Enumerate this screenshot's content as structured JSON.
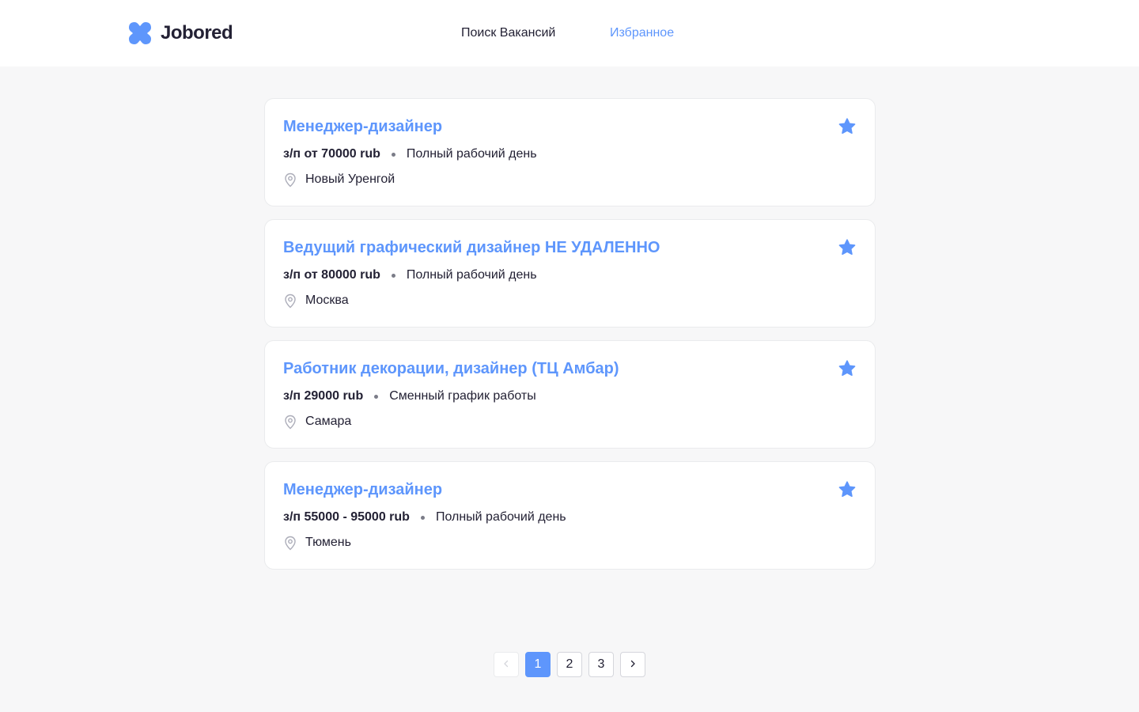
{
  "app": {
    "logo_text": "Jobored",
    "accent": "#5E96FC"
  },
  "nav": {
    "search": "Поиск Вакансий",
    "favorites": "Избранное",
    "active": "favorites"
  },
  "vacancies": [
    {
      "title": "Менеджер-дизайнер",
      "salary": "з/п от 70000 rub",
      "schedule": "Полный рабочий день",
      "location": "Новый Уренгой",
      "favorite": true
    },
    {
      "title": "Ведущий графический дизайнер НЕ УДАЛЕННО",
      "salary": "з/п от 80000 rub",
      "schedule": "Полный рабочий день",
      "location": "Москва",
      "favorite": true
    },
    {
      "title": "Работник декорации, дизайнер (ТЦ Амбар)",
      "salary": "з/п 29000 rub",
      "schedule": "Сменный график работы",
      "location": "Самара",
      "favorite": true
    },
    {
      "title": "Менеджер-дизайнер",
      "salary": "з/п 55000 - 95000 rub",
      "schedule": "Полный рабочий день",
      "location": "Тюмень",
      "favorite": true
    }
  ],
  "pagination": {
    "pages": [
      "1",
      "2",
      "3"
    ],
    "current": "1",
    "prev_icon": "chevron-left-icon",
    "next_icon": "chevron-right-icon"
  }
}
